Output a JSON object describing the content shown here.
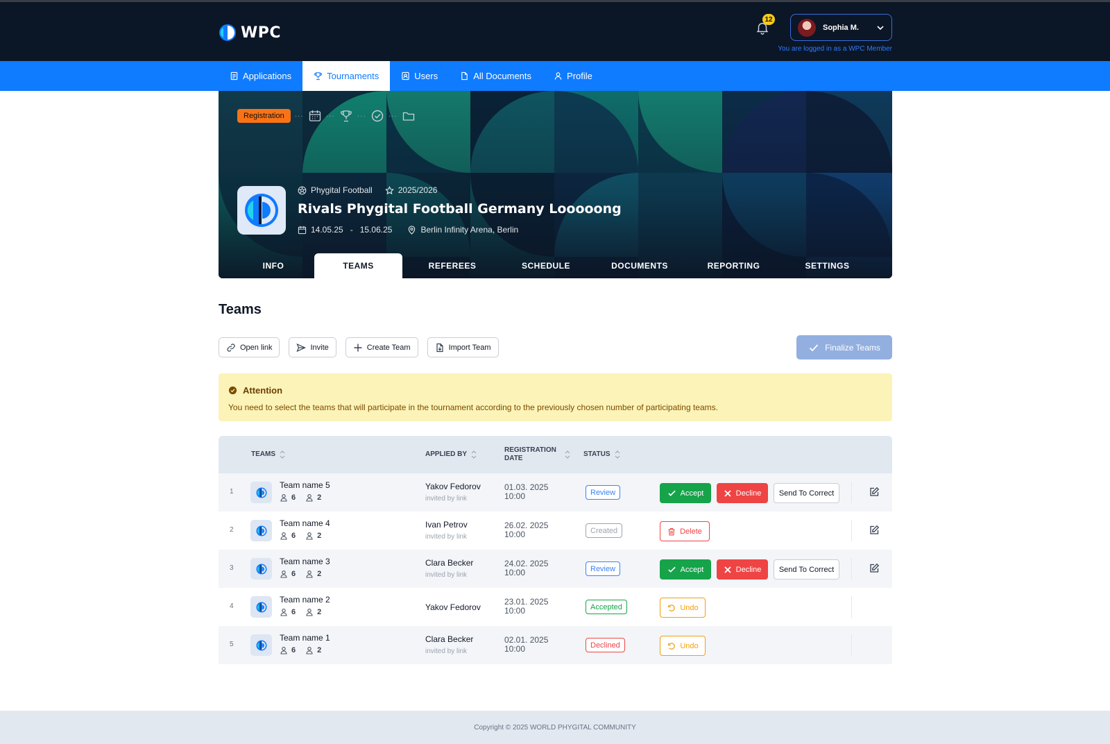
{
  "header": {
    "brand": "WPC",
    "notification_count": "12",
    "user_name": "Sophia M.",
    "logged_note": "You are logged in as a WPC Member"
  },
  "nav": [
    {
      "label": "Applications",
      "icon": "document-list-icon"
    },
    {
      "label": "Tournaments",
      "icon": "trophy-icon",
      "active": true
    },
    {
      "label": "Users",
      "icon": "user-badge-icon"
    },
    {
      "label": "All Documents",
      "icon": "file-icon"
    },
    {
      "label": "Profile",
      "icon": "person-icon"
    }
  ],
  "hero": {
    "stage": "Registration",
    "sport": "Phygital Football",
    "season": "2025/2026",
    "title": "Rivals Phygital Football Germany Looooong",
    "date_start": "14.05.25",
    "date_sep": "-",
    "date_end": "15.06.25",
    "location": "Berlin Infinity Arena, Berlin",
    "tabs": [
      "INFO",
      "TEAMS",
      "REFEREES",
      "SCHEDULE",
      "DOCUMENTS",
      "REPORTING",
      "SETTINGS"
    ],
    "active_tab": "TEAMS"
  },
  "content": {
    "title": "Teams",
    "actions": [
      "Open link",
      "Invite",
      "Create Team",
      "Import Team"
    ],
    "finalize": "Finalize Teams",
    "alert_title": "Attention",
    "alert_text": "You need to select the teams that will participate in the tournament according to the previously chosen number of participating teams."
  },
  "table": {
    "headers": {
      "teams": "TEAMS",
      "applied_by": "APPLIED BY",
      "reg_date_1": "REGISTRATION",
      "reg_date_2": "DATE",
      "status": "STATUS"
    },
    "rows": [
      {
        "num": "1",
        "team": "Team name 5",
        "players": "6",
        "staff": "2",
        "applied_by": "Yakov Fedorov",
        "applied_sub": "invited by link",
        "date": "01.03. 2025",
        "time": "10:00",
        "status": "Review",
        "kind": "review"
      },
      {
        "num": "2",
        "team": "Team name 4",
        "players": "6",
        "staff": "2",
        "applied_by": "Ivan Petrov",
        "applied_sub": "invited by link",
        "date": "26.02. 2025",
        "time": "10:00",
        "status": "Created",
        "kind": "created"
      },
      {
        "num": "3",
        "team": "Team name 3",
        "players": "6",
        "staff": "2",
        "applied_by": "Clara Becker",
        "applied_sub": "invited by link",
        "date": "24.02. 2025",
        "time": "10:00",
        "status": "Review",
        "kind": "review"
      },
      {
        "num": "4",
        "team": "Team name 2",
        "players": "6",
        "staff": "2",
        "applied_by": "Yakov Fedorov",
        "applied_sub": "",
        "date": "23.01. 2025",
        "time": "10:00",
        "status": "Accepted",
        "kind": "accepted"
      },
      {
        "num": "5",
        "team": "Team name 1",
        "players": "6",
        "staff": "2",
        "applied_by": "Clara Becker",
        "applied_sub": "invited by link",
        "date": "02.01. 2025",
        "time": "10:00",
        "status": "Declined",
        "kind": "declined"
      }
    ],
    "labels": {
      "accept": "Accept",
      "decline": "Decline",
      "send_to_correct": "Send To Correct",
      "delete": "Delete",
      "undo": "Undo"
    }
  },
  "footer": {
    "copyright": "Copyright © 2025 WORLD PHYGITAL COMMUNITY"
  },
  "colors": {
    "primary": "#0f7bff",
    "header_bg": "#0b1626",
    "accept": "#16a34a",
    "decline": "#ef4444",
    "undo": "#f59e0b",
    "stage": "#f97316"
  }
}
